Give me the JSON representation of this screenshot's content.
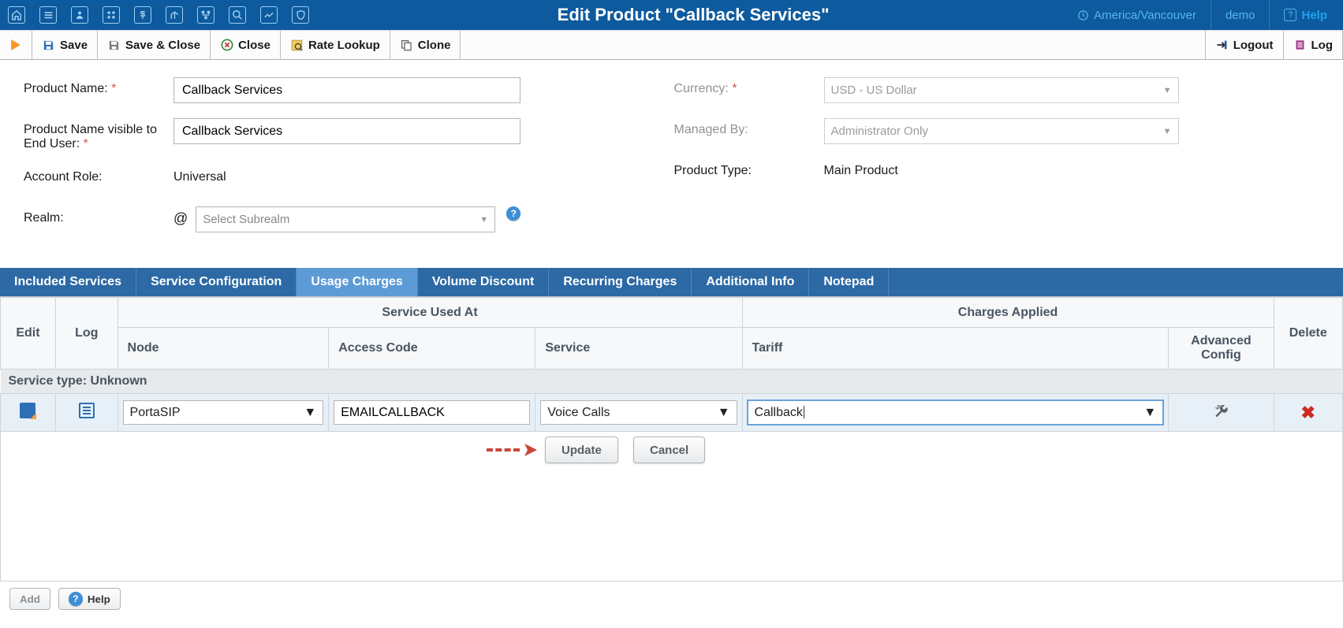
{
  "header": {
    "title": "Edit Product \"Callback Services\"",
    "tz": "America/Vancouver",
    "user": "demo",
    "help": "Help"
  },
  "toolbar": {
    "save": "Save",
    "save_close": "Save & Close",
    "close": "Close",
    "rate_lookup": "Rate Lookup",
    "clone": "Clone",
    "logout": "Logout",
    "log": "Log"
  },
  "form": {
    "product_name_label": "Product Name:",
    "product_name_value": "Callback Services",
    "product_name_eu_label": "Product Name visible to End User:",
    "product_name_eu_value": "Callback Services",
    "account_role_label": "Account Role:",
    "account_role_value": "Universal",
    "realm_label": "Realm:",
    "realm_prefix": "@",
    "realm_placeholder": "Select Subrealm",
    "currency_label": "Currency:",
    "currency_value": "USD - US Dollar",
    "managed_by_label": "Managed By:",
    "managed_by_value": "Administrator Only",
    "product_type_label": "Product Type:",
    "product_type_value": "Main Product"
  },
  "tabs": {
    "included": "Included Services",
    "service_config": "Service Configuration",
    "usage": "Usage Charges",
    "volume": "Volume Discount",
    "recurring": "Recurring Charges",
    "additional": "Additional Info",
    "notepad": "Notepad"
  },
  "grid": {
    "h_edit": "Edit",
    "h_log": "Log",
    "h_service_used": "Service Used At",
    "h_node": "Node",
    "h_access": "Access Code",
    "h_service": "Service",
    "h_charges_applied": "Charges Applied",
    "h_tariff": "Tariff",
    "h_adv": "Advanced Config",
    "h_delete": "Delete",
    "group_label": "Service type: Unknown",
    "row": {
      "node": "PortaSIP",
      "access": "EMAILCALLBACK",
      "service": "Voice Calls",
      "tariff": "Callback"
    },
    "update": "Update",
    "cancel": "Cancel"
  },
  "footer": {
    "add": "Add",
    "help": "Help"
  }
}
